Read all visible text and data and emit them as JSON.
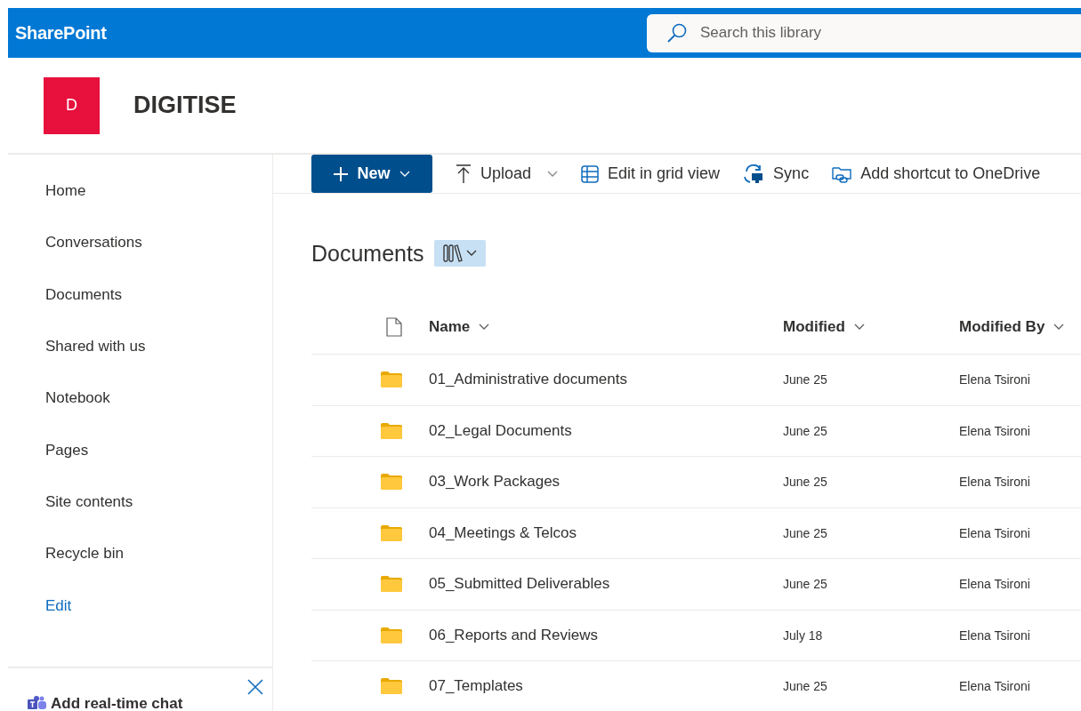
{
  "suite_bar": {
    "app_name": "SharePoint",
    "search": {
      "placeholder": "Search this library"
    }
  },
  "site": {
    "logo_letter": "D",
    "title": "DIGITISE"
  },
  "nav": {
    "items": [
      {
        "label": "Home",
        "kind": "item"
      },
      {
        "label": "Conversations",
        "kind": "item"
      },
      {
        "label": "Documents",
        "kind": "item"
      },
      {
        "label": "Shared with us",
        "kind": "item"
      },
      {
        "label": "Notebook",
        "kind": "item"
      },
      {
        "label": "Pages",
        "kind": "item"
      },
      {
        "label": "Site contents",
        "kind": "item"
      },
      {
        "label": "Recycle bin",
        "kind": "item"
      },
      {
        "label": "Edit",
        "kind": "link"
      }
    ],
    "chat_panel": {
      "label": "Add real-time chat"
    }
  },
  "command_bar": {
    "new_button": "New",
    "commands": [
      {
        "label": "Upload",
        "kind": "upload",
        "has_menu": true
      },
      {
        "label": "Edit in grid view",
        "kind": "grid",
        "has_menu": false
      },
      {
        "label": "Sync",
        "kind": "sync",
        "has_menu": false
      },
      {
        "label": "Add shortcut to OneDrive",
        "kind": "shortcut",
        "has_menu": false
      }
    ]
  },
  "library": {
    "title": "Documents",
    "columns": [
      "Name",
      "Modified",
      "Modified By"
    ],
    "rows": [
      {
        "name": "01_Administrative documents",
        "modified": "June 25",
        "modified_by": "Elena Tsironi"
      },
      {
        "name": "02_Legal Documents",
        "modified": "June 25",
        "modified_by": "Elena Tsironi"
      },
      {
        "name": "03_Work Packages",
        "modified": "June 25",
        "modified_by": "Elena Tsironi"
      },
      {
        "name": "04_Meetings & Telcos",
        "modified": "June 25",
        "modified_by": "Elena Tsironi"
      },
      {
        "name": "05_Submitted Deliverables",
        "modified": "June 25",
        "modified_by": "Elena Tsironi"
      },
      {
        "name": "06_Reports and Reviews",
        "modified": "July 18",
        "modified_by": "Elena Tsironi"
      },
      {
        "name": "07_Templates",
        "modified": "June 25",
        "modified_by": "Elena Tsironi"
      }
    ]
  }
}
